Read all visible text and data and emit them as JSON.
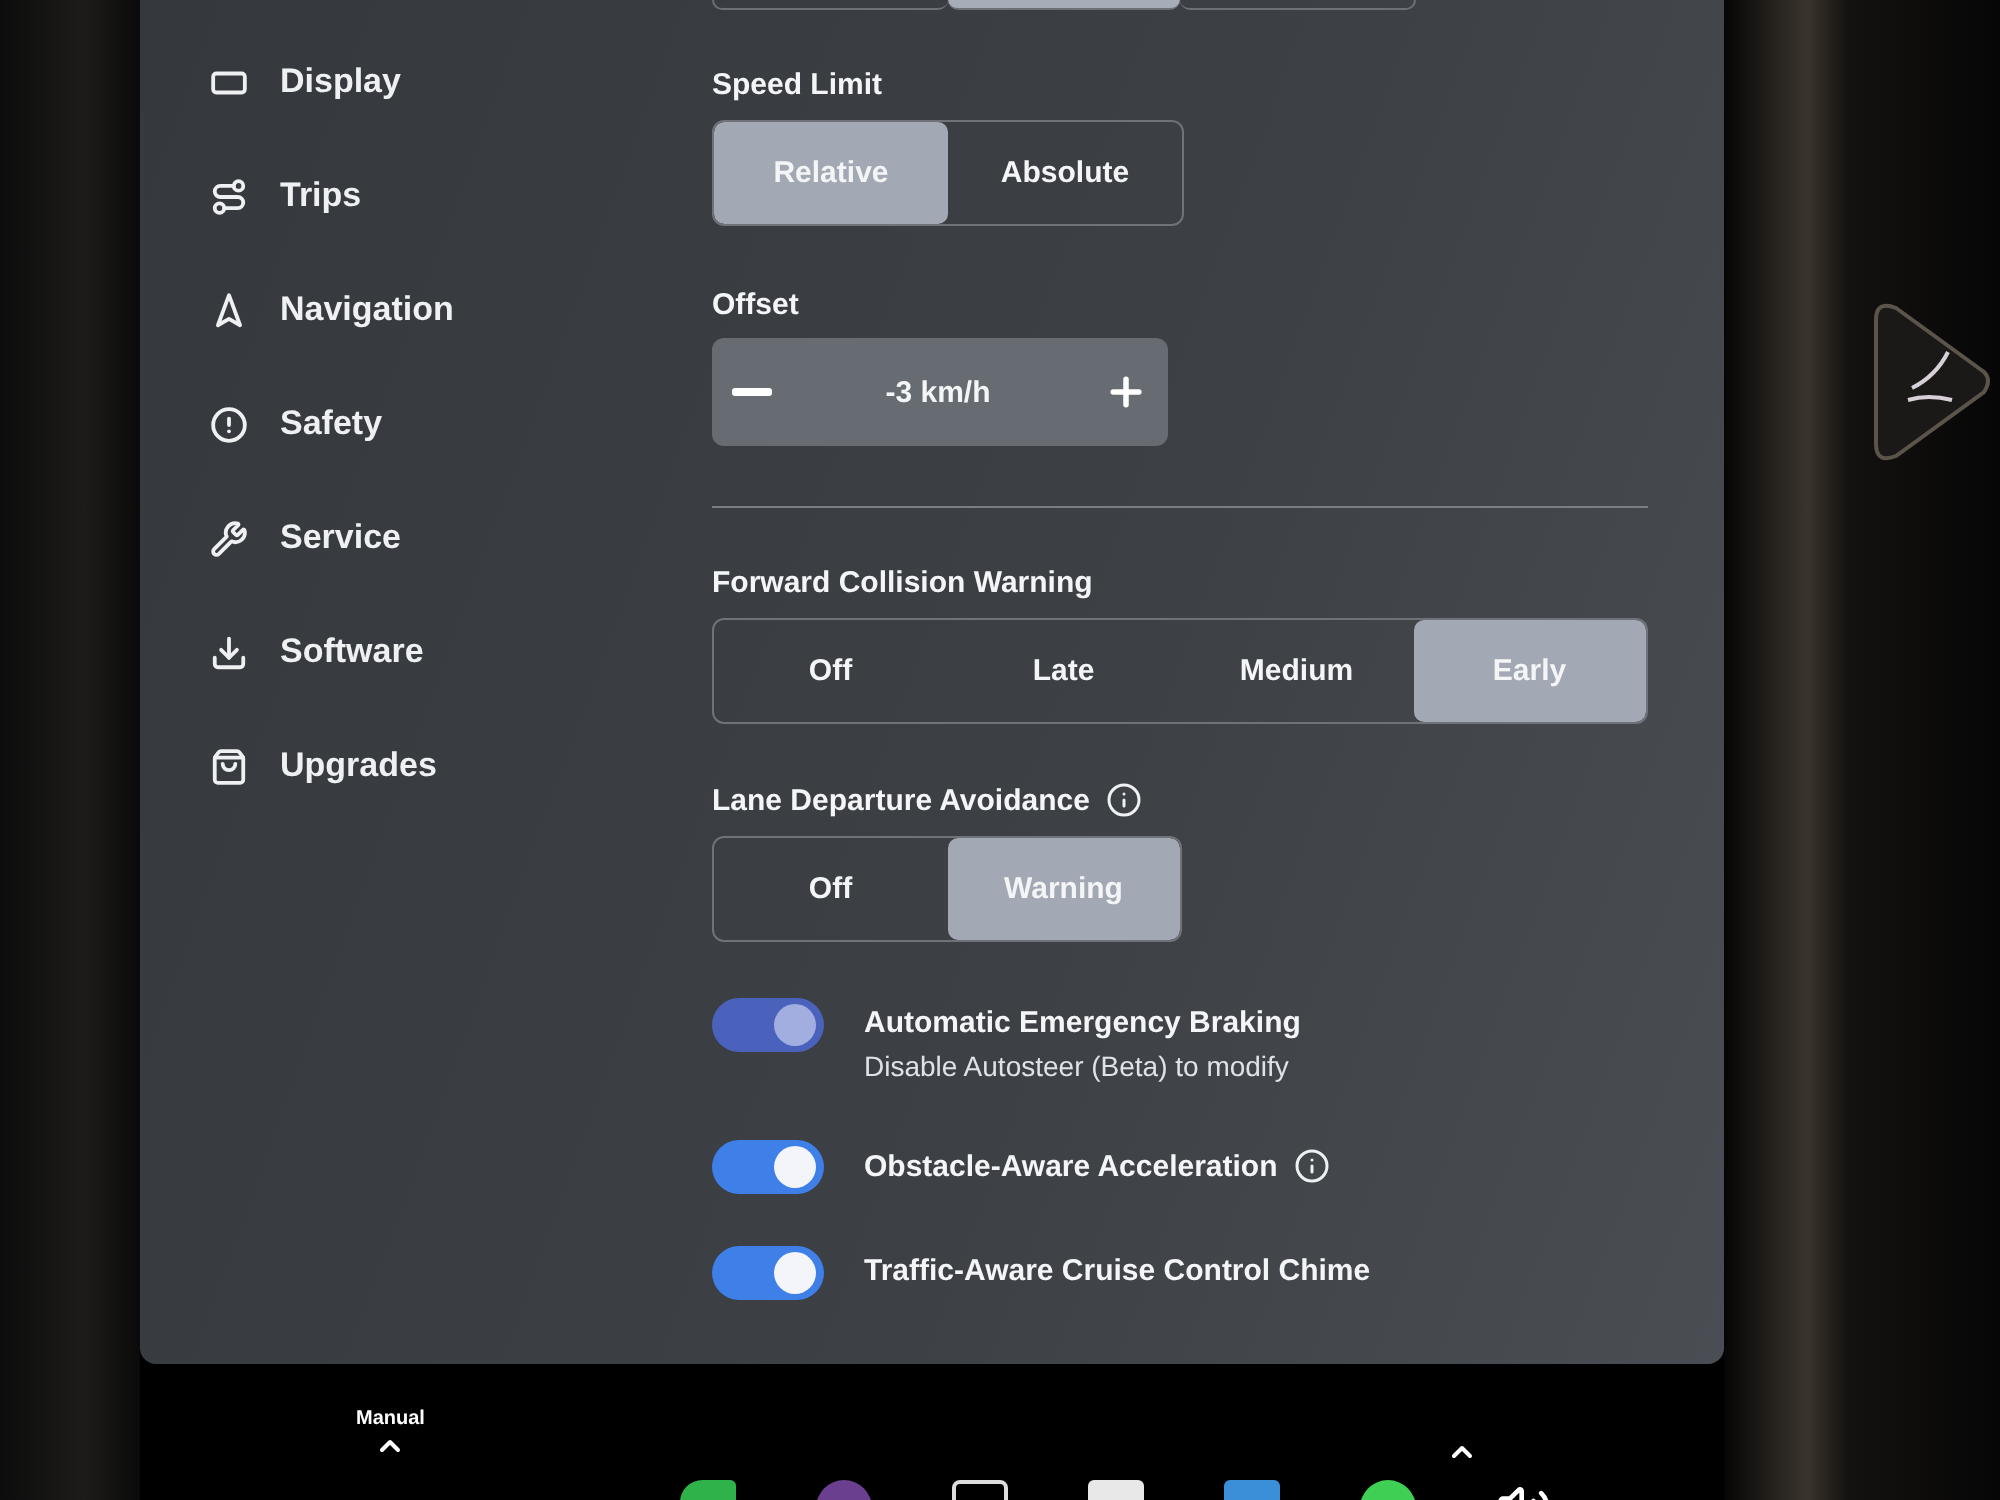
{
  "top_control": {
    "segments": [
      {
        "selected": false
      },
      {
        "selected": true
      },
      {
        "selected": false
      }
    ]
  },
  "sidebar": {
    "items": [
      {
        "label": "Display"
      },
      {
        "label": "Trips"
      },
      {
        "label": "Navigation"
      },
      {
        "label": "Safety"
      },
      {
        "label": "Service"
      },
      {
        "label": "Software"
      },
      {
        "label": "Upgrades"
      }
    ]
  },
  "speed_limit": {
    "label": "Speed Limit",
    "options": [
      {
        "label": "Relative",
        "selected": true
      },
      {
        "label": "Absolute",
        "selected": false
      }
    ]
  },
  "offset": {
    "label": "Offset",
    "value": "-3 km/h"
  },
  "forward_collision_warning": {
    "label": "Forward Collision Warning",
    "options": [
      {
        "label": "Off",
        "selected": false
      },
      {
        "label": "Late",
        "selected": false
      },
      {
        "label": "Medium",
        "selected": false
      },
      {
        "label": "Early",
        "selected": true
      }
    ]
  },
  "lane_departure_avoidance": {
    "label": "Lane Departure Avoidance",
    "info": true,
    "options": [
      {
        "label": "Off",
        "selected": false
      },
      {
        "label": "Warning",
        "selected": true
      }
    ]
  },
  "toggles": [
    {
      "label": "Automatic Emergency Braking",
      "sublabel": "Disable Autosteer (Beta) to modify",
      "on": true,
      "disabled": true
    },
    {
      "label": "Obstacle-Aware Acceleration",
      "on": true,
      "disabled": false,
      "info": true
    },
    {
      "label": "Traffic-Aware Cruise Control Chime",
      "on": true,
      "disabled": false
    }
  ],
  "bottom_bar": {
    "drive_mode": "Manual"
  }
}
